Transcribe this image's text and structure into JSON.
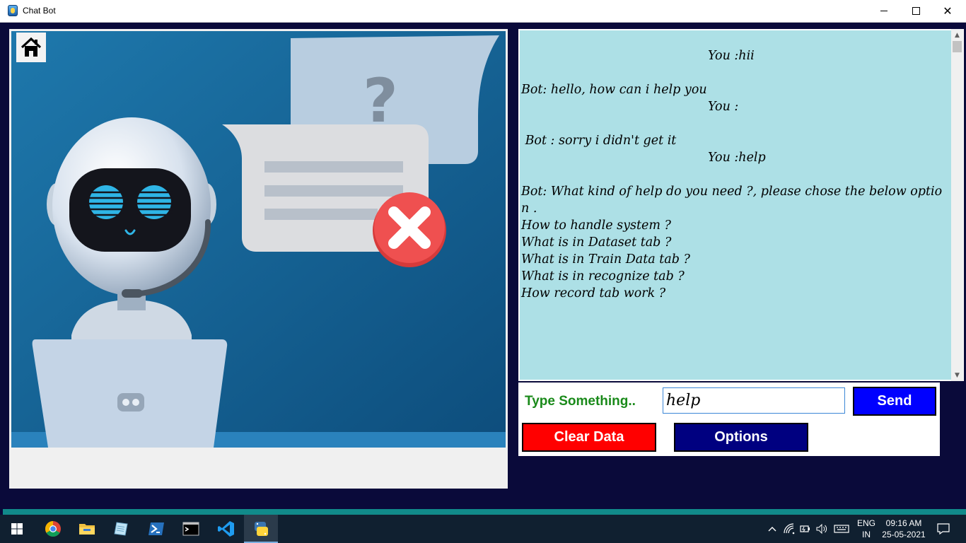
{
  "window": {
    "title": "Chat Bot",
    "controls": {
      "minimize": "minimize-icon",
      "maximize": "maximize-icon",
      "close": "close-icon"
    }
  },
  "home_button": {
    "icon": "home-icon"
  },
  "illustration": {
    "description_icons": [
      "robot-icon",
      "question-mark-icon",
      "error-x-icon",
      "laptop-icon"
    ],
    "question_mark": "?"
  },
  "chat": {
    "messages": [
      {
        "role": "user",
        "text": "You :hii"
      },
      {
        "role": "blank",
        "text": ""
      },
      {
        "role": "bot",
        "text": "Bot: hello, how can i help you"
      },
      {
        "role": "user",
        "text": "You :"
      },
      {
        "role": "blank",
        "text": ""
      },
      {
        "role": "bot",
        "text": " Bot : sorry i didn't get it"
      },
      {
        "role": "user",
        "text": "You :help"
      },
      {
        "role": "blank",
        "text": ""
      },
      {
        "role": "bot",
        "text": "Bot: What kind of help do you need ?, please chose the below option ."
      },
      {
        "role": "bot",
        "text": "How to handle system ?"
      },
      {
        "role": "bot",
        "text": "What is in Dataset tab ?"
      },
      {
        "role": "bot",
        "text": "What is in Train Data tab ?"
      },
      {
        "role": "bot",
        "text": "What is in recognize tab ?"
      },
      {
        "role": "bot",
        "text": "How record tab work ?"
      }
    ]
  },
  "input": {
    "label": "Type Something..",
    "value": "help",
    "send_label": "Send",
    "clear_label": "Clear Data",
    "options_label": "Options"
  },
  "colors": {
    "background": "#0a0a3a",
    "chat_bg": "#ade0e6",
    "label_green": "#1a8a1a",
    "send_blue": "#0000ff",
    "clear_red": "#ff0000",
    "options_navy": "#000080"
  },
  "taskbar": {
    "items": [
      "windows-start-icon",
      "chrome-icon",
      "file-explorer-icon",
      "notepad-icon",
      "powershell-icon",
      "terminal-icon",
      "vscode-icon",
      "python-icon"
    ],
    "language_line1": "ENG",
    "language_line2": "IN",
    "time": "09:16 AM",
    "date": "25-05-2021"
  }
}
